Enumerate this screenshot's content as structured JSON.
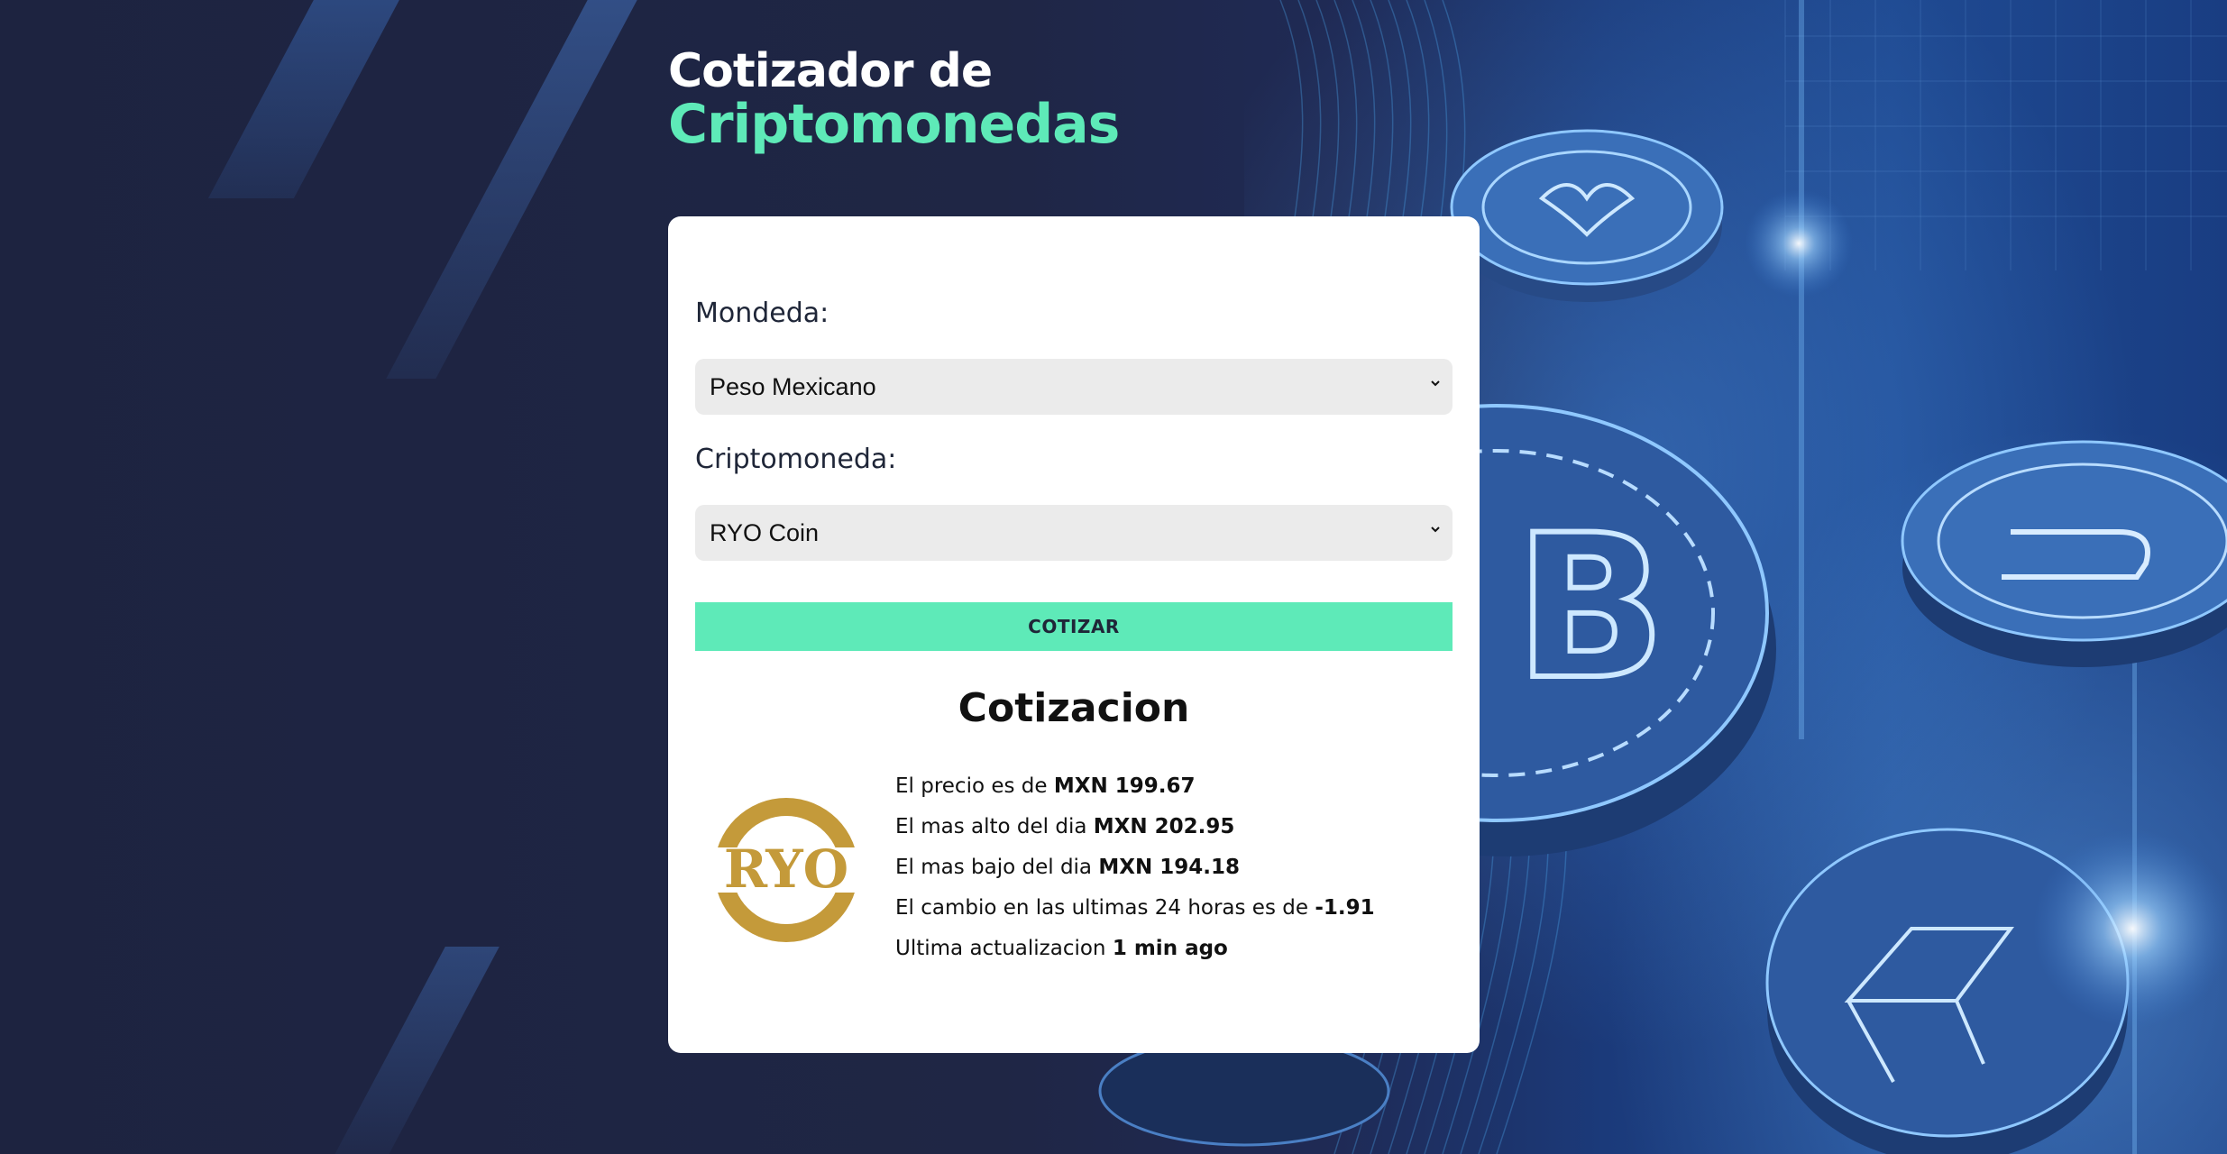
{
  "header": {
    "title_line1": "Cotizador de",
    "title_line2": "Criptomonedas"
  },
  "form": {
    "currency_label": "Mondeda:",
    "currency_value": "Peso Mexicano",
    "crypto_label": "Criptomoneda:",
    "crypto_value": "RYO Coin",
    "submit_label": "COTIZAR"
  },
  "result": {
    "title": "Cotizacion",
    "coin_logo_text": "RYO",
    "price_prefix": "El precio es de ",
    "price_value": "MXN 199.67",
    "high_prefix": "El mas alto del dia ",
    "high_value": "MXN 202.95",
    "low_prefix": "El mas bajo del dia ",
    "low_value": "MXN 194.18",
    "change_prefix": "El cambio en las ultimas 24 horas es de ",
    "change_value": "-1.91",
    "updated_prefix": "Ultima actualizacion ",
    "updated_value": "1 min ago"
  },
  "colors": {
    "accent": "#5eeab8",
    "background": "#1e2440",
    "card": "#ffffff",
    "logo_gold": "#c49a3a"
  },
  "icons": {
    "select_arrow": "chevron-down-icon",
    "coin_logo": "ryo-coin-logo"
  }
}
